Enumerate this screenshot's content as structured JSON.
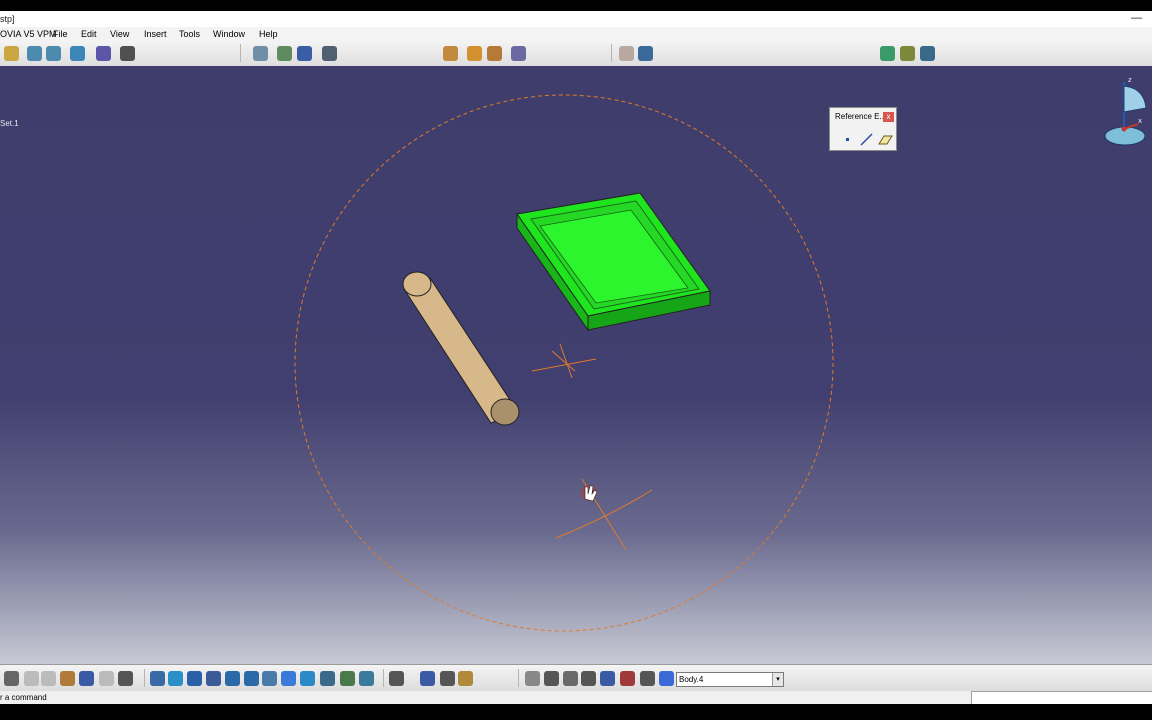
{
  "window": {
    "title": "stp]",
    "minimize_glyph": "—"
  },
  "menu": {
    "app": "OVIA V5 VPM",
    "items": [
      "File",
      "Edit",
      "View",
      "Insert",
      "Tools",
      "Window",
      "Help"
    ]
  },
  "tree": {
    "label": "Set.1"
  },
  "reference_panel": {
    "title": "Reference E...",
    "close_glyph": "x",
    "tools": [
      "point-icon",
      "line-icon",
      "plane-icon"
    ]
  },
  "compass": {
    "z": "z",
    "x": "x"
  },
  "bottom_toolbar": {
    "body_select": "Body.4",
    "dropdown_glyph": "▾"
  },
  "status": {
    "prompt": "r a command"
  },
  "colors": {
    "viewport_top": "#3e3d6c",
    "viewport_bottom": "#c8cad5",
    "tray_green": "#1fe51f",
    "cylinder_tan": "#d6b88a",
    "selection_orange": "#e07a2a"
  }
}
